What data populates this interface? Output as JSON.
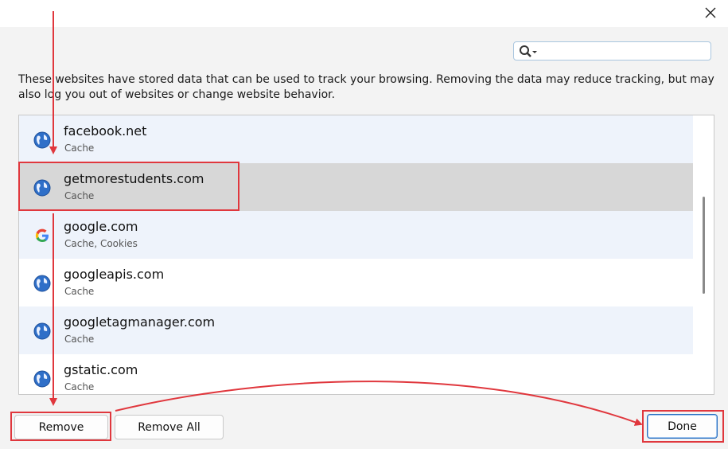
{
  "dialog": {
    "close_glyph": "✕"
  },
  "search": {
    "value": "",
    "placeholder": ""
  },
  "description": "These websites have stored data that can be used to track your browsing. Removing the data may reduce tracking, but may also log you out of websites or change website behavior.",
  "sites": [
    {
      "name": "facebook.net",
      "detail": "Cache",
      "icon": "globe-icon"
    },
    {
      "name": "getmorestudents.com",
      "detail": "Cache",
      "icon": "globe-icon"
    },
    {
      "name": "google.com",
      "detail": "Cache, Cookies",
      "icon": "google-icon"
    },
    {
      "name": "googleapis.com",
      "detail": "Cache",
      "icon": "globe-icon"
    },
    {
      "name": "googletagmanager.com",
      "detail": "Cache",
      "icon": "globe-icon"
    },
    {
      "name": "gstatic.com",
      "detail": "Cache",
      "icon": "globe-icon"
    }
  ],
  "selected_site": "getmorestudents.com",
  "buttons": {
    "remove": "Remove",
    "remove_all": "Remove All",
    "done": "Done"
  },
  "colors": {
    "annotation": "#e0373d",
    "selected_row": "#d7d7d7",
    "alt_row": "#eef3fb"
  }
}
